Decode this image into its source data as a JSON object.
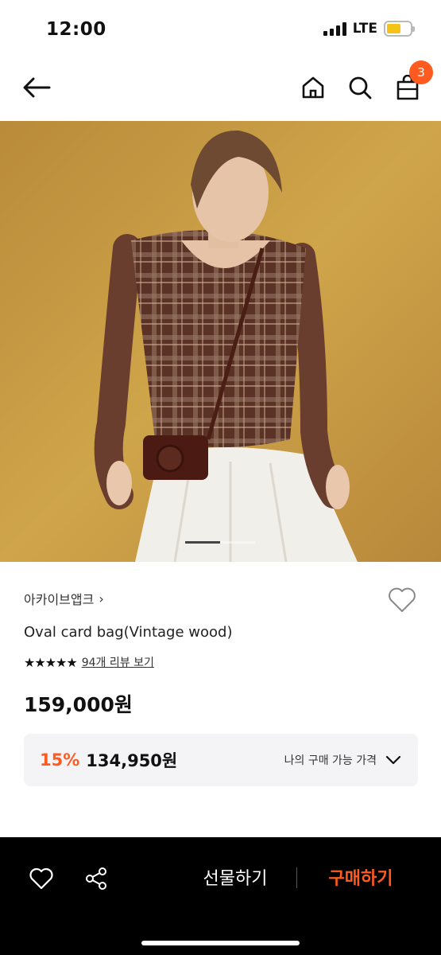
{
  "status_bar": {
    "time": "12:00",
    "network": "LTE",
    "battery_color": "#f5c316"
  },
  "nav": {
    "back_icon": "arrow-left-icon",
    "home_icon": "home-icon",
    "search_icon": "search-icon",
    "cart_icon": "shopping-bag-icon",
    "cart_count": "3",
    "badge_color": "#ff5a1f"
  },
  "hero": {
    "image": "product-photo",
    "carousel_active_index": 1,
    "carousel_count": 2
  },
  "product": {
    "brand": "아카이브앱크",
    "brand_chevron": "›",
    "name": "Oval card bag(Vintage wood)",
    "rating_stars": 5,
    "star_glyphs": "★★★★★",
    "review_link": "94개 리뷰 보기",
    "price": "159,000원",
    "wishlist_icon": "heart-outline-icon"
  },
  "discount": {
    "percent": "15%",
    "price": "134,950원",
    "label": "나의 구매 가능 가격",
    "accent_color": "#ff5a1f",
    "chevron_icon": "chevron-down-icon"
  },
  "bottom_bar": {
    "heart_icon": "heart-outline-icon",
    "share_icon": "share-icon",
    "gift_label": "선물하기",
    "buy_label": "구매하기",
    "buy_color": "#ff5a1f"
  }
}
